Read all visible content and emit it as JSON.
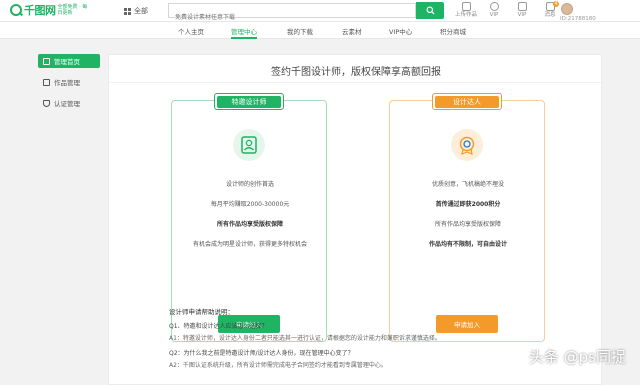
{
  "header": {
    "logo_text": "千图网",
    "logo_tagline": "全部免费 · 每日更新",
    "category_label": "全部",
    "search_placeholder": "免费设计素材任意下载",
    "icons": [
      {
        "name": "upload-icon",
        "label": "上传作品"
      },
      {
        "name": "vip-icon",
        "label": "VIP"
      },
      {
        "name": "vip-crown-icon",
        "label": "VIP"
      },
      {
        "name": "message-icon",
        "label": "消息"
      }
    ],
    "message_count": "4",
    "user_id": "ID:21788180"
  },
  "nav": {
    "items": [
      "个人主页",
      "管理中心",
      "我的下载",
      "云素材",
      "VIP中心",
      "积分商城"
    ],
    "active_index": 1
  },
  "sidebar": {
    "items": [
      {
        "label": "管理首页",
        "icon": "home-icon"
      },
      {
        "label": "作品管理",
        "icon": "settings-icon"
      },
      {
        "label": "认证管理",
        "icon": "shield-icon"
      }
    ],
    "active_index": 0
  },
  "main": {
    "title": "签约千图设计师，版权保障享高额回报",
    "cards": [
      {
        "tag": "特邀设计师",
        "icon": "designer-badge-icon",
        "lines": [
          "设计师的创作首选",
          "每月平均赚取2000-30000元",
          "所有作品均享受版权保障",
          "有机会成为明星设计师，获得更多特权机会"
        ],
        "button": "申请加入",
        "accent": "#1fb364"
      },
      {
        "tag": "设计达人",
        "icon": "expert-badge-icon",
        "lines": [
          "优质创意，飞机稿绝不埋没",
          "首传通过即获2000积分",
          "所有作品均享受版权保障",
          "作品均有不限制，可自由设计"
        ],
        "button": "申请加入",
        "accent": "#f39a2b"
      }
    ],
    "faq": {
      "heading": "设计师申请帮助说明：",
      "items": [
        {
          "q": "Q1、特邀和设计达人应该怎么选择？",
          "a": "A1：特邀设计师，设计达人身份二者只能选其一进行认证，请根据您的设计能力和兼职诉求谨慎选择。"
        },
        {
          "q": "Q2：为什么我之前是特邀设计师/设计达人身份，现在管理中心变了？",
          "a": "A2：千图认证系统升级，所有设计师需完成电子合同签约才能看到专属管理中心。"
        }
      ]
    }
  },
  "watermark": "头条 @ps同捉",
  "colors": {
    "primary": "#1fb364",
    "accent": "#f39a2b"
  }
}
